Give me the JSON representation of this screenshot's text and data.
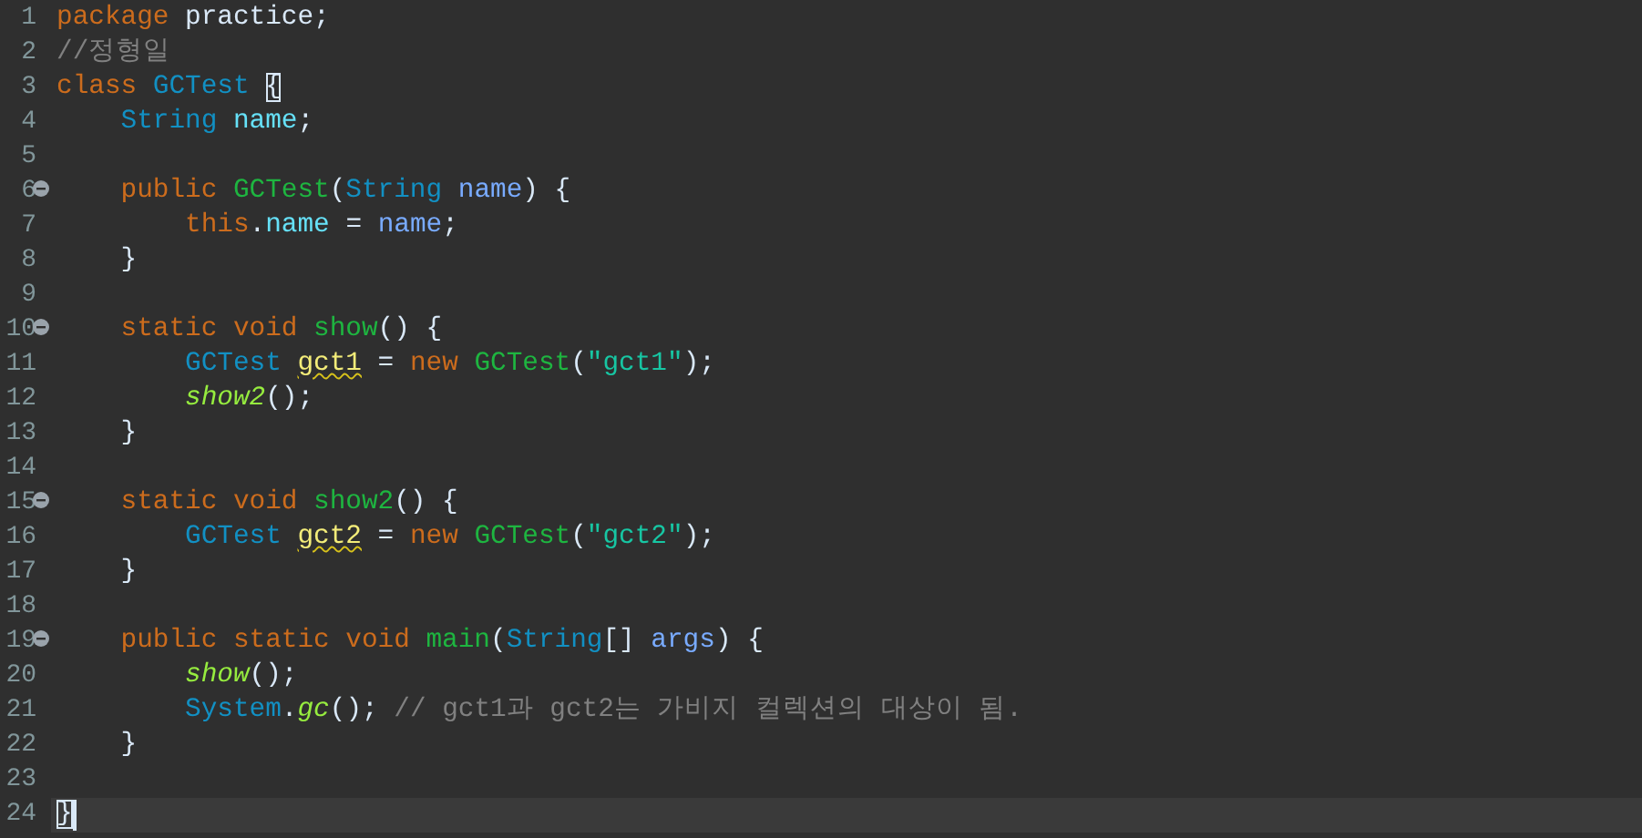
{
  "editor": {
    "lines": [
      {
        "number": "1",
        "folding": false,
        "current": false,
        "tokens": [
          {
            "text": "package",
            "kind": "keyword"
          },
          {
            "text": " practice;",
            "kind": "plain"
          }
        ]
      },
      {
        "number": "2",
        "folding": false,
        "current": false,
        "tokens": [
          {
            "text": "//정형일",
            "kind": "comment"
          }
        ]
      },
      {
        "number": "3",
        "folding": false,
        "current": false,
        "tokens": [
          {
            "text": "class",
            "kind": "keyword"
          },
          {
            "text": " GCTest ",
            "kind": "type"
          },
          {
            "text": "{",
            "kind": "matched-bracket"
          }
        ]
      },
      {
        "number": "4",
        "folding": false,
        "current": false,
        "tokens": [
          {
            "text": "    String",
            "kind": "type"
          },
          {
            "text": " name",
            "kind": "field"
          },
          {
            "text": ";",
            "kind": "plain"
          }
        ]
      },
      {
        "number": "5",
        "folding": false,
        "current": false
      },
      {
        "number": "6",
        "folding": true,
        "current": false,
        "tokens": [
          {
            "text": "    public",
            "kind": "keyword"
          },
          {
            "text": " GCTest",
            "kind": "declaration"
          },
          {
            "text": "(",
            "kind": "plain"
          },
          {
            "text": "String",
            "kind": "type"
          },
          {
            "text": " name",
            "kind": "parameter"
          },
          {
            "text": ") {",
            "kind": "plain"
          }
        ]
      },
      {
        "number": "7",
        "folding": false,
        "current": false,
        "tokens": [
          {
            "text": "        this",
            "kind": "keyword"
          },
          {
            "text": ".",
            "kind": "plain"
          },
          {
            "text": "name",
            "kind": "field"
          },
          {
            "text": " = ",
            "kind": "plain"
          },
          {
            "text": "name",
            "kind": "parameter"
          },
          {
            "text": ";",
            "kind": "plain"
          }
        ]
      },
      {
        "number": "8",
        "folding": false,
        "current": false,
        "tokens": [
          {
            "text": "    }",
            "kind": "plain"
          }
        ]
      },
      {
        "number": "9",
        "folding": false,
        "current": false
      },
      {
        "number": "10",
        "folding": true,
        "current": false,
        "tokens": [
          {
            "text": "    static",
            "kind": "keyword"
          },
          {
            "text": " void",
            "kind": "keyword"
          },
          {
            "text": " show",
            "kind": "declaration"
          },
          {
            "text": "() {",
            "kind": "plain"
          }
        ]
      },
      {
        "number": "11",
        "folding": false,
        "current": false,
        "tokens": [
          {
            "text": "        GCTest ",
            "kind": "type"
          },
          {
            "text": "gct1",
            "kind": "warned-local"
          },
          {
            "text": " = ",
            "kind": "plain"
          },
          {
            "text": "new",
            "kind": "keyword"
          },
          {
            "text": " GCTest",
            "kind": "declaration"
          },
          {
            "text": "(",
            "kind": "plain"
          },
          {
            "text": "\"gct1\"",
            "kind": "string"
          },
          {
            "text": ");",
            "kind": "plain"
          }
        ]
      },
      {
        "number": "12",
        "folding": false,
        "current": false,
        "tokens": [
          {
            "text": "        show2",
            "kind": "static-call"
          },
          {
            "text": "();",
            "kind": "plain"
          }
        ]
      },
      {
        "number": "13",
        "folding": false,
        "current": false,
        "tokens": [
          {
            "text": "    }",
            "kind": "plain"
          }
        ]
      },
      {
        "number": "14",
        "folding": false,
        "current": false
      },
      {
        "number": "15",
        "folding": true,
        "current": false,
        "tokens": [
          {
            "text": "    static",
            "kind": "keyword"
          },
          {
            "text": " void",
            "kind": "keyword"
          },
          {
            "text": " show2",
            "kind": "declaration"
          },
          {
            "text": "() {",
            "kind": "plain"
          }
        ]
      },
      {
        "number": "16",
        "folding": false,
        "current": false,
        "tokens": [
          {
            "text": "        GCTest ",
            "kind": "type"
          },
          {
            "text": "gct2",
            "kind": "warned-local"
          },
          {
            "text": " = ",
            "kind": "plain"
          },
          {
            "text": "new",
            "kind": "keyword"
          },
          {
            "text": " GCTest",
            "kind": "declaration"
          },
          {
            "text": "(",
            "kind": "plain"
          },
          {
            "text": "\"gct2\"",
            "kind": "string"
          },
          {
            "text": ");",
            "kind": "plain"
          }
        ]
      },
      {
        "number": "17",
        "folding": false,
        "current": false,
        "tokens": [
          {
            "text": "    }",
            "kind": "plain"
          }
        ]
      },
      {
        "number": "18",
        "folding": false,
        "current": false
      },
      {
        "number": "19",
        "folding": true,
        "current": false,
        "tokens": [
          {
            "text": "    public",
            "kind": "keyword"
          },
          {
            "text": " static",
            "kind": "keyword"
          },
          {
            "text": " void",
            "kind": "keyword"
          },
          {
            "text": " main",
            "kind": "declaration"
          },
          {
            "text": "(",
            "kind": "plain"
          },
          {
            "text": "String",
            "kind": "type"
          },
          {
            "text": "[] ",
            "kind": "plain"
          },
          {
            "text": "args",
            "kind": "parameter"
          },
          {
            "text": ") {",
            "kind": "plain"
          }
        ]
      },
      {
        "number": "20",
        "folding": false,
        "current": false,
        "tokens": [
          {
            "text": "        show",
            "kind": "static-call"
          },
          {
            "text": "();",
            "kind": "plain"
          }
        ]
      },
      {
        "number": "21",
        "folding": false,
        "current": false,
        "tokens": [
          {
            "text": "        System",
            "kind": "type"
          },
          {
            "text": ".",
            "kind": "plain"
          },
          {
            "text": "gc",
            "kind": "static-call"
          },
          {
            "text": "(); ",
            "kind": "plain"
          },
          {
            "text": "// gct1과 gct2는 가비지 컬렉션의 대상이 됨.",
            "kind": "comment"
          }
        ]
      },
      {
        "number": "22",
        "folding": false,
        "current": false,
        "tokens": [
          {
            "text": "    }",
            "kind": "plain"
          }
        ]
      },
      {
        "number": "23",
        "folding": false,
        "current": false
      },
      {
        "number": "24",
        "folding": false,
        "current": true,
        "tokens": [
          {
            "text": "}",
            "kind": "matched-bracket"
          }
        ]
      }
    ]
  }
}
